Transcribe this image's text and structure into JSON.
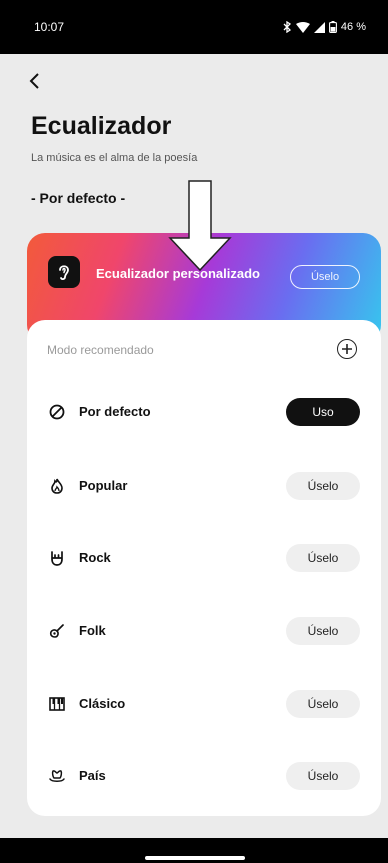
{
  "status_bar": {
    "time": "10:07",
    "battery": "46 %",
    "icons": [
      "bluetooth-icon",
      "wifi-icon",
      "signal-icon",
      "battery-icon"
    ]
  },
  "header": {
    "back_icon": "chevron-left-icon",
    "title": "Ecualizador",
    "subtitle": "La música es el alma de la poesía",
    "current_mode": "- Por defecto -"
  },
  "custom_equalizer": {
    "icon": "ear-icon",
    "label": "Ecualizador personalizado",
    "button_label": "Úselo",
    "colors": [
      "#f25a3b",
      "#f0466b",
      "#a63ad8",
      "#6a6df0",
      "#36c7ee"
    ]
  },
  "recommended": {
    "section_label": "Modo recomendado",
    "add_icon": "plus-circle-icon",
    "presets": [
      {
        "name": "Por defecto",
        "icon": "no-entry-icon",
        "button": "Uso",
        "active": true
      },
      {
        "name": "Popular",
        "icon": "flame-icon",
        "button": "Úselo",
        "active": false
      },
      {
        "name": "Rock",
        "icon": "rock-hand-icon",
        "button": "Úselo",
        "active": false
      },
      {
        "name": "Folk",
        "icon": "guitar-icon",
        "button": "Úselo",
        "active": false
      },
      {
        "name": "Clásico",
        "icon": "piano-icon",
        "button": "Úselo",
        "active": false
      },
      {
        "name": "País",
        "icon": "cowboy-hat-icon",
        "button": "Úselo",
        "active": false
      }
    ]
  }
}
